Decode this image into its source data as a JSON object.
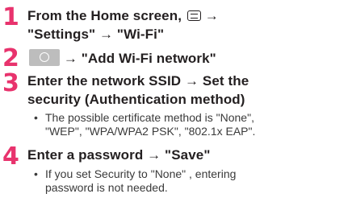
{
  "steps": [
    {
      "number": "1",
      "line1_prefix": "From the Home screen, ",
      "icon": "menu-key-icon",
      "line1_suffix": " →",
      "line2": "\"Settings\" → \"Wi-Fi\""
    },
    {
      "number": "2",
      "icon": "circle-key-icon",
      "line1_suffix": " → \"Add Wi-Fi network\""
    },
    {
      "number": "3",
      "line1": "Enter the network SSID → Set the",
      "line2": "security (Authentication method)",
      "note_line1": "The possible certificate method is \"None\",",
      "note_line2": "\"WEP\", \"WPA/WPA2 PSK\", \"802.1x EAP\"."
    },
    {
      "number": "4",
      "line1": "Enter a password → \"Save\"",
      "note_line1": "If you set Security to \"None\" , entering",
      "note_line2": "password is not needed."
    }
  ],
  "bullet": "•"
}
